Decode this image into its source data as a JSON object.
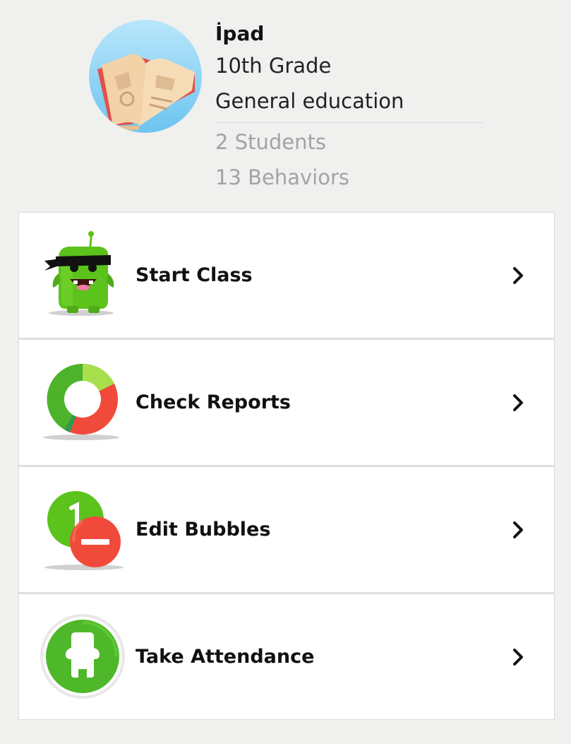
{
  "class_header": {
    "name": "İpad",
    "grade": "10th Grade",
    "subject": "General education",
    "students": "2 Students",
    "behaviors": "13 Behaviors"
  },
  "menu": {
    "items": [
      {
        "label": "Start Class",
        "icon": "monster-icon"
      },
      {
        "label": "Check Reports",
        "icon": "donut-chart-icon"
      },
      {
        "label": "Edit Bubbles",
        "icon": "bubbles-icon"
      },
      {
        "label": "Take Attendance",
        "icon": "attendance-icon"
      }
    ]
  },
  "colors": {
    "background": "#f0f0ef",
    "green": "#5cc21c",
    "red": "#f04a3a",
    "sky_blue": "#8fd3f5"
  }
}
